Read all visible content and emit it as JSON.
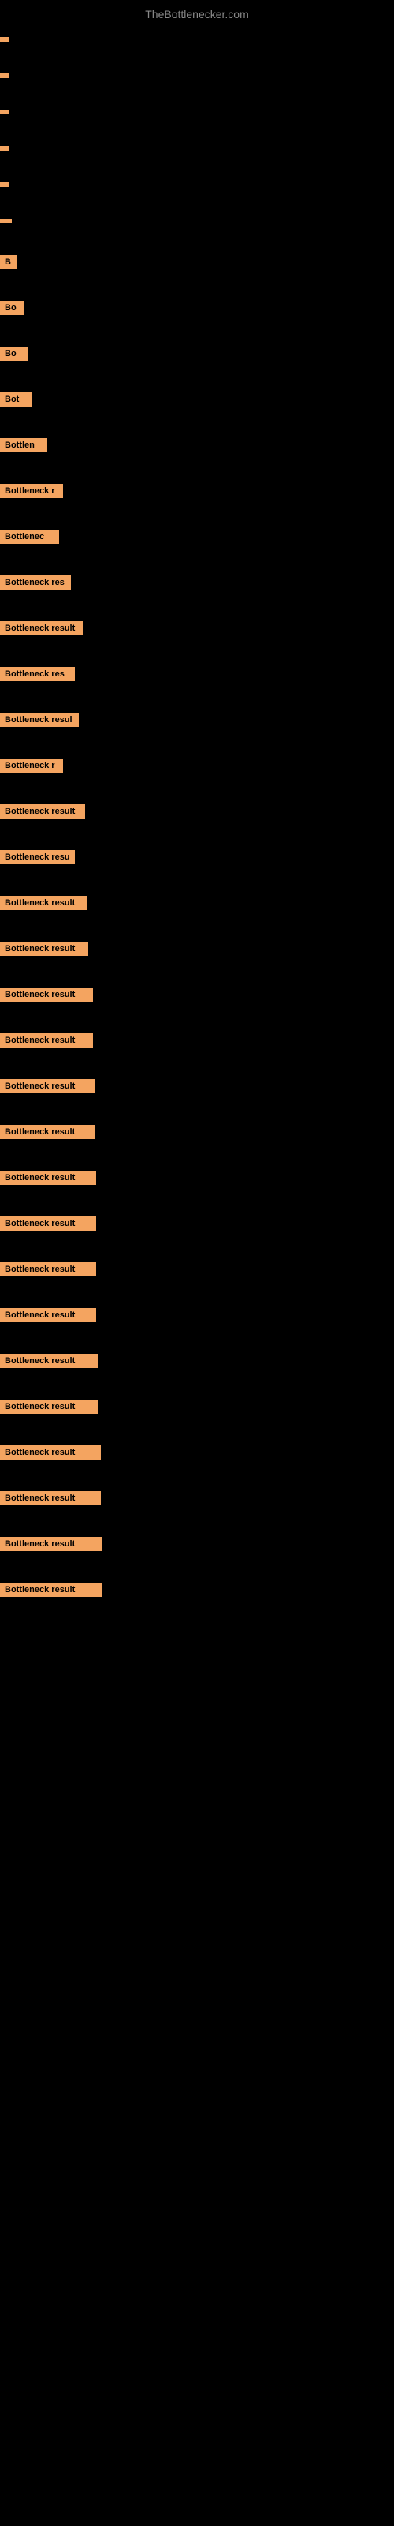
{
  "site_title": "TheBottlenecker.com",
  "rows": [
    {
      "id": 1,
      "label": "",
      "class": "row-1"
    },
    {
      "id": 2,
      "label": "",
      "class": "row-2"
    },
    {
      "id": 3,
      "label": "",
      "class": "row-3"
    },
    {
      "id": 4,
      "label": "",
      "class": "row-4"
    },
    {
      "id": 5,
      "label": "",
      "class": "row-5"
    },
    {
      "id": 6,
      "label": "",
      "class": "row-6"
    },
    {
      "id": 7,
      "label": "B",
      "class": "row-7"
    },
    {
      "id": 8,
      "label": "Bo",
      "class": "row-8"
    },
    {
      "id": 9,
      "label": "Bo",
      "class": "row-9"
    },
    {
      "id": 10,
      "label": "Bot",
      "class": "row-10"
    },
    {
      "id": 11,
      "label": "Bottlen",
      "class": "row-11"
    },
    {
      "id": 12,
      "label": "Bottleneck r",
      "class": "row-12"
    },
    {
      "id": 13,
      "label": "Bottlenec",
      "class": "row-13"
    },
    {
      "id": 14,
      "label": "Bottleneck res",
      "class": "row-14"
    },
    {
      "id": 15,
      "label": "Bottleneck result",
      "class": "row-15"
    },
    {
      "id": 16,
      "label": "Bottleneck res",
      "class": "row-16"
    },
    {
      "id": 17,
      "label": "Bottleneck resul",
      "class": "row-17"
    },
    {
      "id": 18,
      "label": "Bottleneck r",
      "class": "row-18"
    },
    {
      "id": 19,
      "label": "Bottleneck result",
      "class": "row-19"
    },
    {
      "id": 20,
      "label": "Bottleneck resu",
      "class": "row-20"
    },
    {
      "id": 21,
      "label": "Bottleneck result",
      "class": "row-21"
    },
    {
      "id": 22,
      "label": "Bottleneck result",
      "class": "row-22"
    },
    {
      "id": 23,
      "label": "Bottleneck result",
      "class": "row-23"
    },
    {
      "id": 24,
      "label": "Bottleneck result",
      "class": "row-24"
    },
    {
      "id": 25,
      "label": "Bottleneck result",
      "class": "row-25"
    },
    {
      "id": 26,
      "label": "Bottleneck result",
      "class": "row-26"
    },
    {
      "id": 27,
      "label": "Bottleneck result",
      "class": "row-27"
    },
    {
      "id": 28,
      "label": "Bottleneck result",
      "class": "row-28"
    },
    {
      "id": 29,
      "label": "Bottleneck result",
      "class": "row-29"
    },
    {
      "id": 30,
      "label": "Bottleneck result",
      "class": "row-30"
    },
    {
      "id": 31,
      "label": "Bottleneck result",
      "class": "row-31"
    },
    {
      "id": 32,
      "label": "Bottleneck result",
      "class": "row-32"
    },
    {
      "id": 33,
      "label": "Bottleneck result",
      "class": "row-33"
    },
    {
      "id": 34,
      "label": "Bottleneck result",
      "class": "row-34"
    },
    {
      "id": 35,
      "label": "Bottleneck result",
      "class": "row-35"
    },
    {
      "id": 36,
      "label": "Bottleneck result",
      "class": "row-36"
    }
  ],
  "colors": {
    "background": "#000000",
    "label_bg": "#F4A460",
    "bar_bg": "#1a1a1a",
    "title": "#888888"
  }
}
